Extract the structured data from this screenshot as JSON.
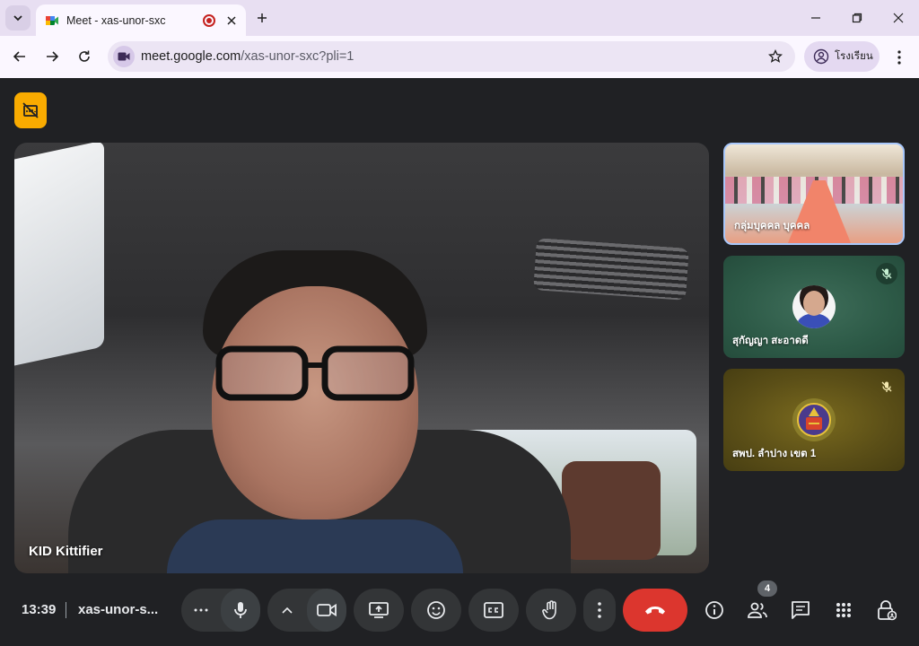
{
  "browser": {
    "tab_title": "Meet - xas-unor-sxc",
    "url_host": "meet.google.com",
    "url_path": "/xas-unor-sxc?pli=1",
    "profile_label": "โรงเรียน"
  },
  "meet": {
    "main_participant": "KID Kittifier",
    "participants": [
      {
        "name": "กลุ่มบุคคล บุคคล"
      },
      {
        "name": "สุกัญญา สะอาดดี"
      },
      {
        "name": "สพป. ลำปาง เขต 1"
      }
    ],
    "clock": "13:39",
    "meeting_code": "xas-unor-s...",
    "people_count": "4"
  },
  "icons": {
    "tab_search": "chevron-down-icon",
    "favicon": "meet-logo-icon",
    "recording": "recording-icon",
    "presentation": "present-off-icon",
    "mic_off": "mic-off-icon"
  },
  "colors": {
    "end_call": "#dc362e",
    "control_bg": "#333537",
    "badge": "#f9ab00",
    "selected_tile_border": "#a8c7fa"
  }
}
